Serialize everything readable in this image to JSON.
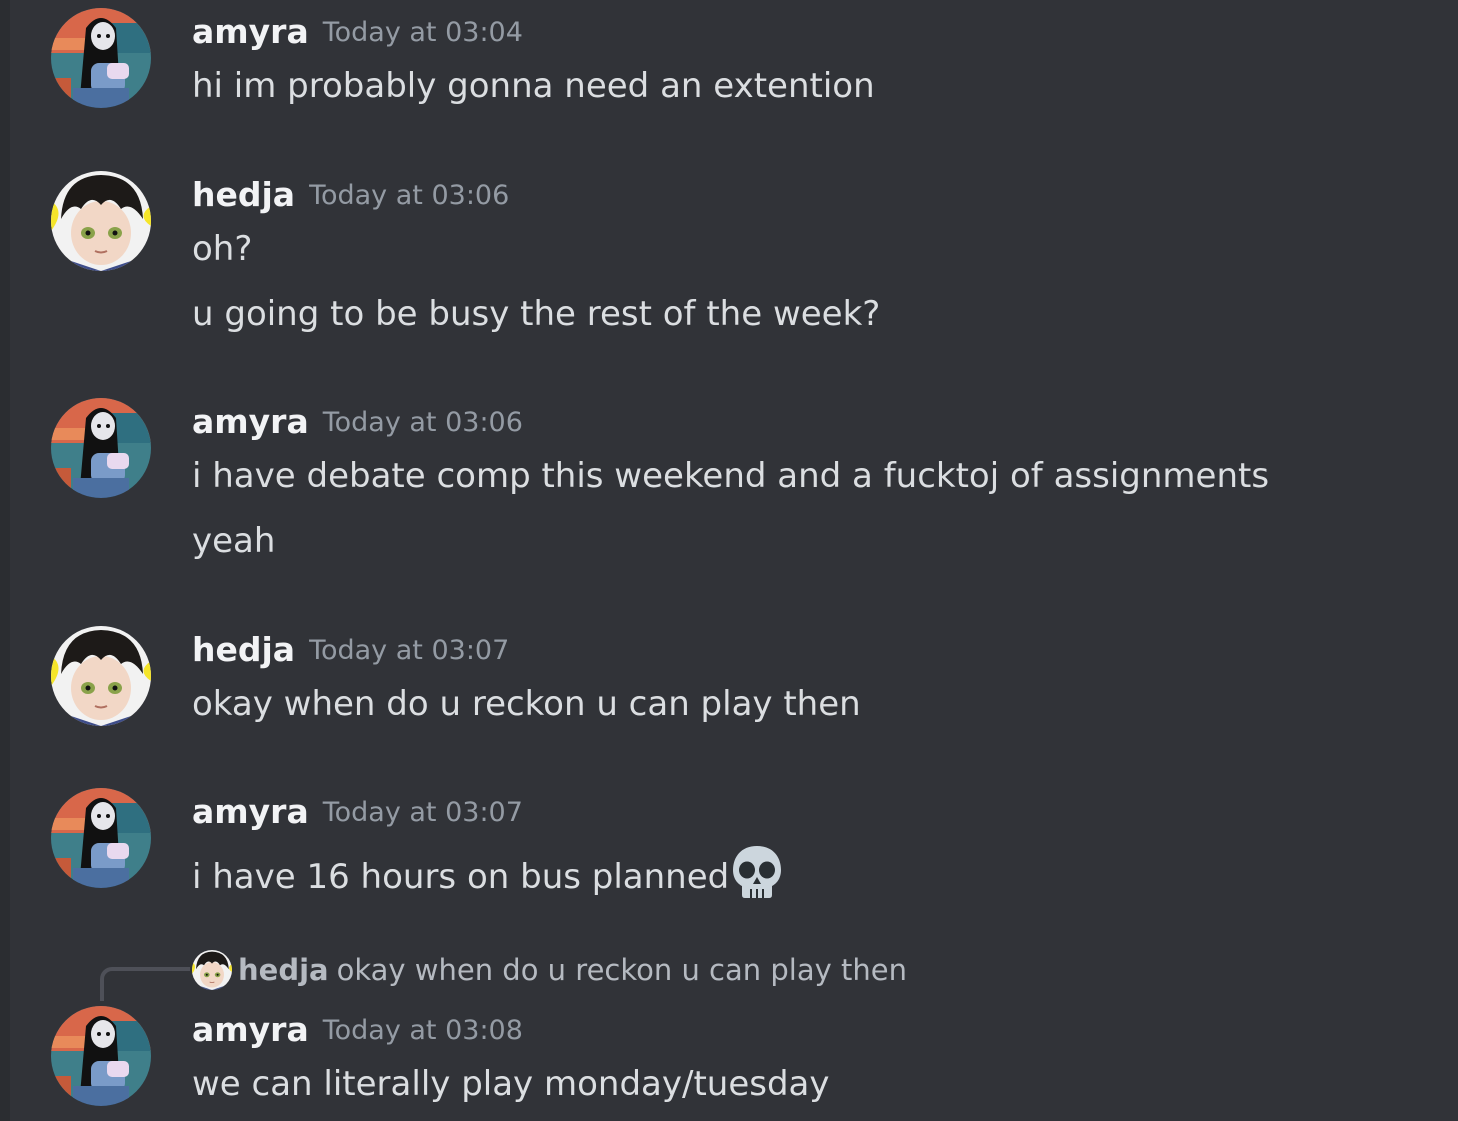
{
  "users": {
    "amyra": {
      "name": "amyra",
      "avatar_icon": "amyra-avatar-icon"
    },
    "hedja": {
      "name": "hedja",
      "avatar_icon": "hedja-avatar-icon"
    }
  },
  "messages": [
    {
      "author": "amyra",
      "timestamp": "Today at 03:04",
      "lines": [
        "hi im probably gonna need an extention"
      ]
    },
    {
      "author": "hedja",
      "timestamp": "Today at 03:06",
      "lines": [
        "oh?",
        "u going to be busy the rest of the week?"
      ]
    },
    {
      "author": "amyra",
      "timestamp": "Today at 03:06",
      "lines": [
        "i have debate comp this weekend and a fucktoj of assignments",
        "yeah"
      ]
    },
    {
      "author": "hedja",
      "timestamp": "Today at 03:07",
      "lines": [
        "okay when do u reckon u can play then"
      ]
    },
    {
      "author": "amyra",
      "timestamp": "Today at 03:07",
      "lines": [
        "i have 16 hours on bus planned"
      ],
      "trailing_emoji": "skull-emoji"
    },
    {
      "author": "amyra",
      "timestamp": "Today at 03:08",
      "lines": [
        "we can literally play monday/tuesday"
      ],
      "reply_to": {
        "author": "hedja",
        "text": "okay when do u reckon u can play then"
      }
    }
  ],
  "colors": {
    "background": "#313338",
    "sidebar_edge": "#2b2d31",
    "author_name": "#f2f3f5",
    "message_text": "#dbdee1",
    "timestamp": "#949ba4",
    "reply_text": "#b5bac1",
    "reply_spine": "#4e5058"
  }
}
